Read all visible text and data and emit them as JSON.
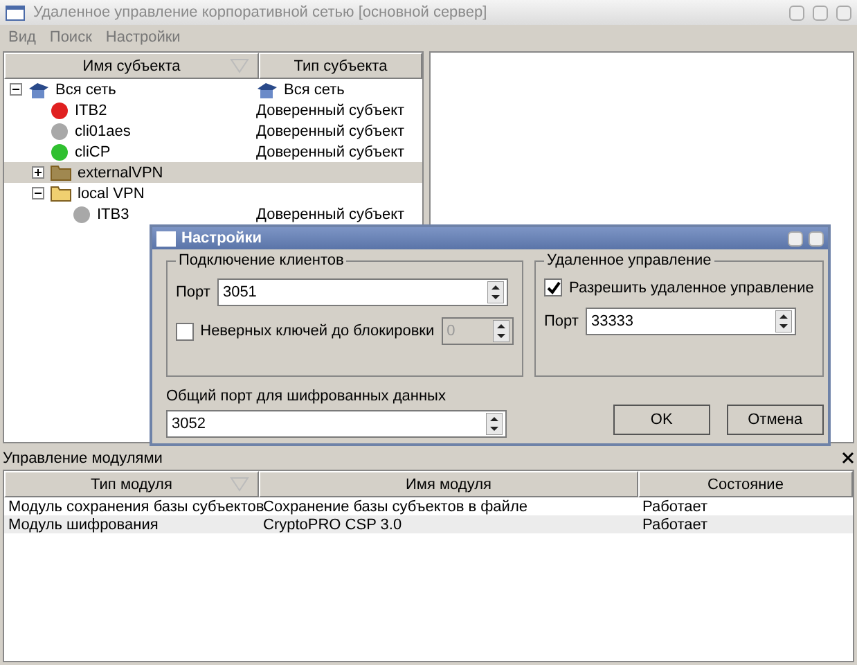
{
  "window": {
    "title": "Удаленное управление корпоративной сетью [основной сервер]"
  },
  "menu": [
    "Вид",
    "Поиск",
    "Настройки"
  ],
  "tree": {
    "columns": [
      {
        "label": "Имя субъекта",
        "sorted": true
      },
      {
        "label": "Тип субъекта",
        "sorted": false
      }
    ],
    "items": [
      {
        "kind": "network",
        "name": "Вся сеть",
        "type": "Вся сеть",
        "type_icon": true,
        "expanded": true,
        "selected": false,
        "children": [
          {
            "kind": "status",
            "color": "#e02020",
            "name": "ITB2",
            "type": "Доверенный субъект",
            "selected": false
          },
          {
            "kind": "status",
            "color": "#a8a8a8",
            "name": "cli01aes",
            "type": "Доверенный субъект",
            "selected": false
          },
          {
            "kind": "status",
            "color": "#30c030",
            "name": "cliCP",
            "type": "Доверенный субъект",
            "selected": false
          },
          {
            "kind": "folder",
            "name": "externalVPN",
            "expanded": false,
            "selected": true
          },
          {
            "kind": "folder",
            "name": "local VPN",
            "expanded": true,
            "selected": false,
            "children": [
              {
                "kind": "status",
                "color": "#a8a8a8",
                "name": "ITB3",
                "type": "Доверенный субъект",
                "selected": false
              }
            ]
          }
        ]
      }
    ]
  },
  "modules": {
    "title": "Управление модулями",
    "columns": [
      {
        "label": "Тип модуля",
        "sorted": true
      },
      {
        "label": "Имя модуля",
        "sorted": false
      },
      {
        "label": "Состояние",
        "sorted": false
      }
    ],
    "rows": [
      [
        "Модуль сохранения базы субъектов",
        "Сохранение базы субъектов в файле",
        "Работает"
      ],
      [
        "Модуль шифрования",
        "CryptoPRO CSP 3.0",
        "Работает"
      ]
    ]
  },
  "dialog": {
    "title": "Настройки",
    "clients": {
      "title": "Подключение клиентов",
      "port_label": "Порт",
      "port": "3051",
      "lock_label": "Неверных ключей до блокировки",
      "lock_checked": false,
      "lock_value": "0"
    },
    "remote": {
      "title": "Удаленное управление",
      "allow_label": "Разрешить удаленное управление",
      "allow_checked": true,
      "port_label": "Порт",
      "port": "33333"
    },
    "shared_label": "Общий порт для шифрованных данных",
    "shared_port": "3052",
    "buttons": [
      "OK",
      "Отмена"
    ]
  }
}
